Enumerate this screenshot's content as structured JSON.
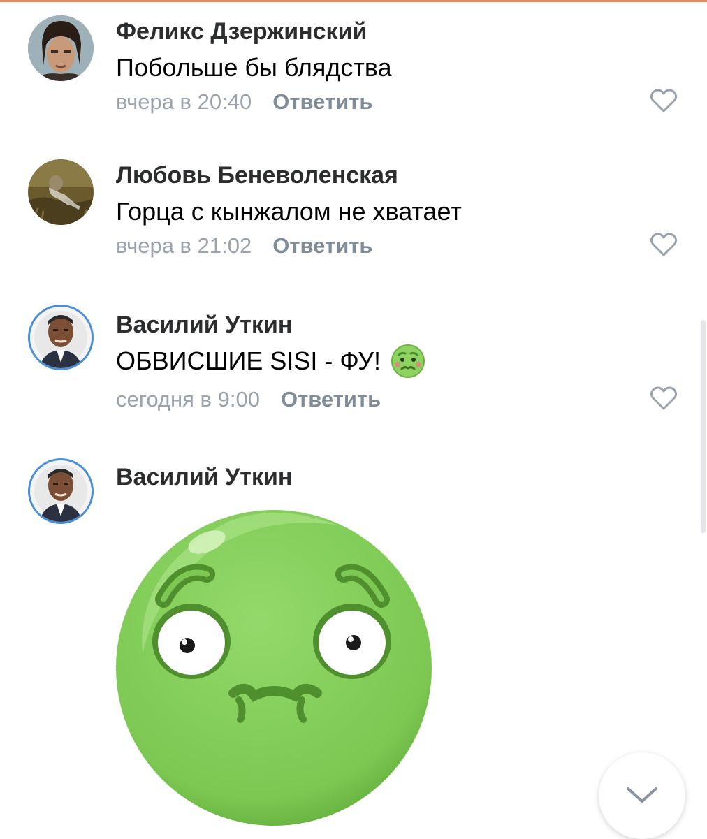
{
  "comments": [
    {
      "author": "Феликс Дзержинский",
      "text": "Побольше бы блядства",
      "time": "вчера в 20:40",
      "reply_label": "Ответить",
      "avatar_icon": "man-portrait-avatar"
    },
    {
      "author": "Любовь Беневоленская",
      "text": "Горца с кынжалом не хватает",
      "time": "вчера в 21:02",
      "reply_label": "Ответить",
      "avatar_icon": "woman-in-field-avatar"
    },
    {
      "author": "Василий Уткин",
      "text": "ОБВИСШИЕ SISI - ФУ!",
      "emoji": "nauseated-face-emoji",
      "time": "сегодня в 9:00",
      "reply_label": "Ответить",
      "avatar_icon": "man-portrait-avatar"
    },
    {
      "author": "Василий Уткин",
      "sticker": "nauseated-green-face-sticker",
      "avatar_icon": "man-portrait-avatar"
    }
  ],
  "icons": {
    "like": "heart-outline-icon",
    "scroll_down": "chevron-down-icon"
  },
  "colors": {
    "author": "#2c2d2e",
    "meta": "#99a2ad",
    "reply": "#818c99",
    "avatar_ring": "#4a8fd9",
    "sticker_green": "#86d35d",
    "top_accent": "#e08a5e"
  }
}
